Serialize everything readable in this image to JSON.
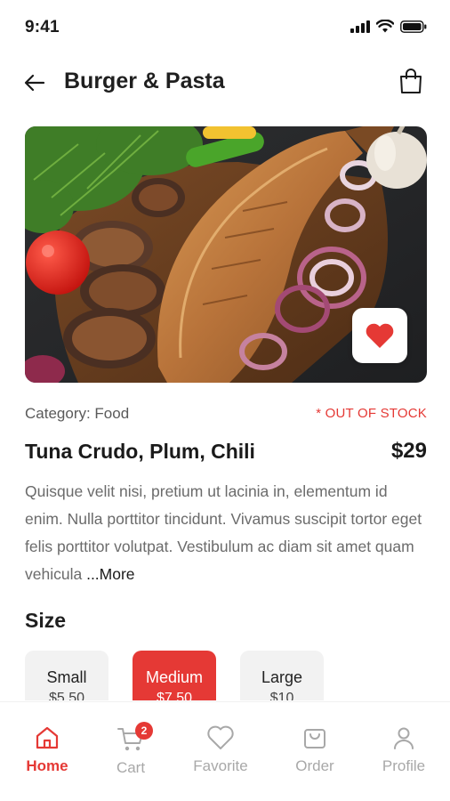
{
  "status_bar": {
    "time": "9:41"
  },
  "header": {
    "title": "Burger & Pasta"
  },
  "product": {
    "category": "Category: Food",
    "stock_status": "* OUT OF STOCK",
    "name": "Tuna Crudo, Plum, Chili",
    "price": "$29",
    "description": "Quisque velit nisi, pretium ut lacinia in, elementum id enim. Nulla porttitor tincidunt. Vivamus suscipit tortor eget felis porttitor volutpat. Vestibulum ac diam sit amet quam vehicula ",
    "more_label": "...More"
  },
  "size_section": {
    "heading": "Size",
    "options": [
      {
        "label": "Small",
        "price": "$5.50",
        "selected": false
      },
      {
        "label": "Medium",
        "price": "$7.50",
        "selected": true
      },
      {
        "label": "Large",
        "price": "$10",
        "selected": false
      }
    ]
  },
  "bottom_nav": {
    "items": [
      {
        "label": "Home",
        "icon": "home-icon",
        "active": true
      },
      {
        "label": "Cart",
        "icon": "cart-icon",
        "active": false,
        "badge": "2"
      },
      {
        "label": "Favorite",
        "icon": "heart-icon",
        "active": false
      },
      {
        "label": "Order",
        "icon": "bag-icon",
        "active": false
      },
      {
        "label": "Profile",
        "icon": "user-icon",
        "active": false
      }
    ]
  },
  "colors": {
    "accent": "#e53935",
    "muted": "#a8a8a8"
  }
}
